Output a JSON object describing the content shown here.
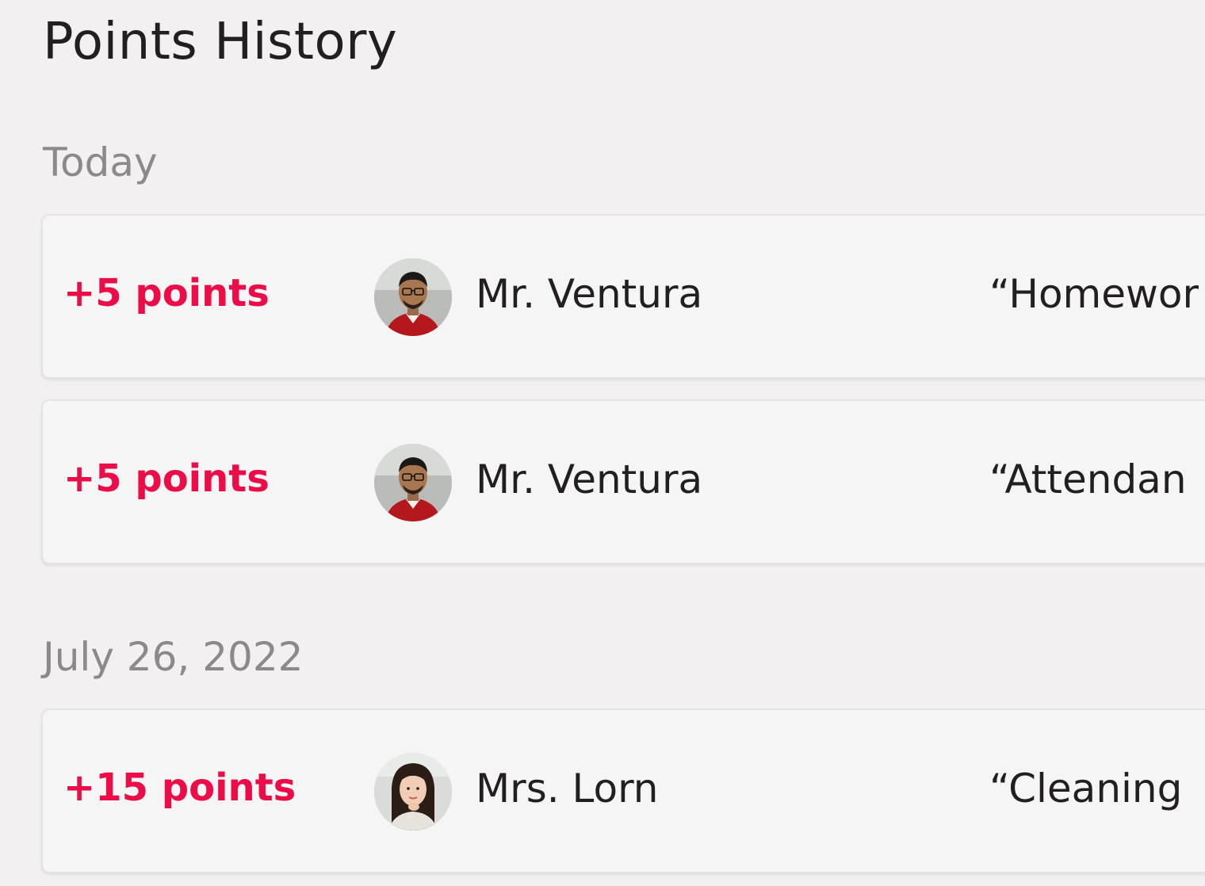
{
  "page": {
    "title": "Points History"
  },
  "sections": [
    {
      "label": "Today",
      "entries": [
        {
          "points": "+5 points",
          "teacher": "Mr. Ventura",
          "reason": "“Homewor"
        },
        {
          "points": "+5 points",
          "teacher": "Mr. Ventura",
          "reason": "“Attendan"
        }
      ]
    },
    {
      "label": "July 26, 2022",
      "entries": [
        {
          "points": "+15 points",
          "teacher": "Mrs. Lorn",
          "reason": "“Cleaning"
        }
      ]
    }
  ],
  "colors": {
    "background": "#f2f0f1",
    "card": "#f5f5f5",
    "points_accent": "#ec0c47",
    "text_primary": "#231f20",
    "text_secondary": "#8d8889"
  }
}
